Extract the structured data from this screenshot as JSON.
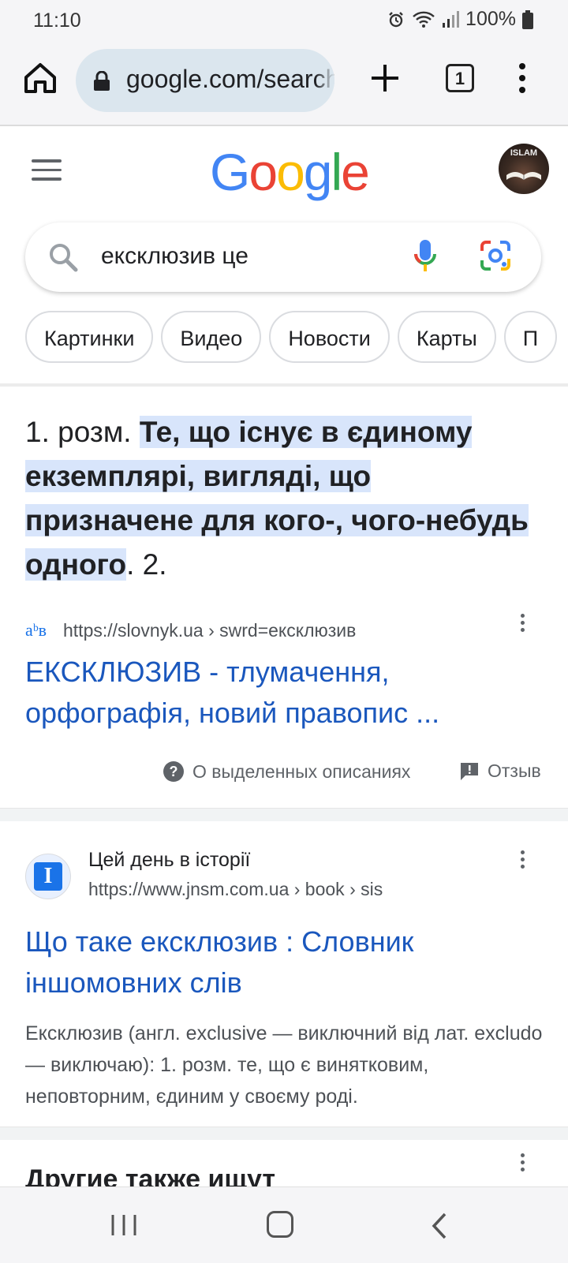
{
  "status_bar": {
    "time": "11:10",
    "battery": "100%"
  },
  "browser": {
    "url": "google.com/search",
    "tab_count": "1"
  },
  "google": {
    "logo_letters": [
      {
        "char": "G",
        "color": "#4285F4"
      },
      {
        "char": "o",
        "color": "#EA4335"
      },
      {
        "char": "o",
        "color": "#FBBC05"
      },
      {
        "char": "g",
        "color": "#4285F4"
      },
      {
        "char": "l",
        "color": "#34A853"
      },
      {
        "char": "e",
        "color": "#EA4335"
      }
    ],
    "avatar_text": "ISLAM"
  },
  "search": {
    "query": "ексклюзив це"
  },
  "chips": [
    "Картинки",
    "Видео",
    "Новости",
    "Карты",
    "П"
  ],
  "featured_snippet": {
    "prefix": "1. розм. ",
    "highlight": "Те, що існує в єдиному екземплярі, вигляді, що призначене для кого-, чого-небудь одного",
    "suffix": ". 2.",
    "source_url": "https://slovnyk.ua › swrd=ексклюзив",
    "favicon_text": "аᵇв",
    "title": "ЕКСКЛЮЗИВ - тлумачення, орфографія, новий правопис ...",
    "about_label": "О выделенных описаниях",
    "feedback_label": "Отзыв"
  },
  "result2": {
    "favicon_text": "I",
    "site_name": "Цей день в історії",
    "url": "https://www.jnsm.com.ua › book › sis",
    "title": "Що таке ексклюзив : Словник іншомовних слів",
    "description": "Ексклюзив (англ. exclusive — виключний від лат. excludo — виключаю): 1. розм. те, що є винятковим, неповторним, єдиним у своєму роді."
  },
  "more": {
    "heading": "Другие также ищут"
  }
}
